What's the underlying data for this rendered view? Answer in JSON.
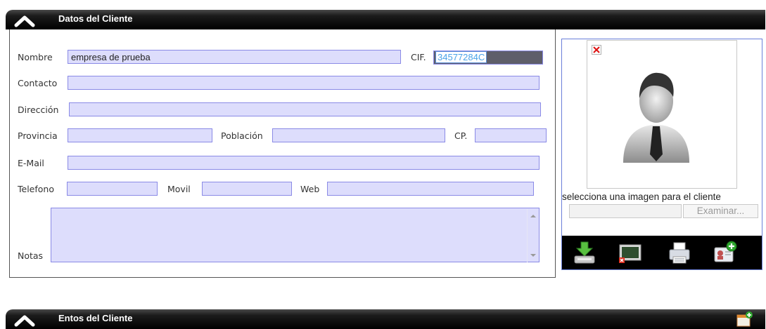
{
  "client_panel": {
    "title": "Datos del Cliente",
    "fields": {
      "nombre": {
        "label": "Nombre",
        "value": "empresa de prueba"
      },
      "cif": {
        "label": "CIF.",
        "value": "34577284C"
      },
      "contacto": {
        "label": "Contacto",
        "value": ""
      },
      "direccion": {
        "label": "Dirección",
        "value": ""
      },
      "provincia": {
        "label": "Provincia",
        "value": ""
      },
      "poblacion": {
        "label": "Población",
        "value": ""
      },
      "cp": {
        "label": "CP.",
        "value": ""
      },
      "email": {
        "label": "E-Mail",
        "value": ""
      },
      "telefono": {
        "label": "Telefono",
        "value": ""
      },
      "movil": {
        "label": "Movil",
        "value": ""
      },
      "web": {
        "label": "Web",
        "value": ""
      },
      "notas": {
        "label": "Notas",
        "value": ""
      }
    },
    "image": {
      "caption": "selecciona una imagen para el cliente",
      "browse_label": "Examinar..."
    },
    "toolbar_icons": [
      "save-icon",
      "remove-image-icon",
      "print-icon",
      "add-contact-icon"
    ]
  },
  "entities_panel": {
    "title": "Entos del Cliente",
    "action_icon": "add-window-icon"
  },
  "colors": {
    "header_bg": "#000000",
    "field_bg": "#ddddfc",
    "field_border": "#8a8ae6",
    "panel_border": "#6a7fd9"
  }
}
